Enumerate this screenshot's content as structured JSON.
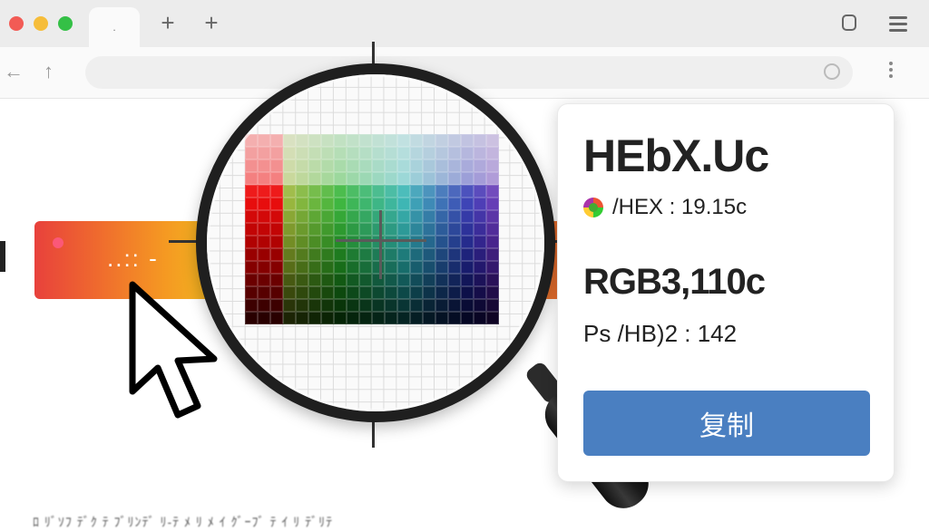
{
  "browser": {
    "tab_label": ".",
    "new_tab_symbol": "+",
    "back_symbol": "←",
    "forward_symbol": "↑"
  },
  "page": {
    "bar_text": "..:: -",
    "footer_text": "ﾛ ﾘﾞｿﾌ ﾃﾞｸ ﾃ ﾌﾞﾘﾝﾃﾞ ﾘ-ﾃ ﾒ ﾘ ﾒ ｲ ｸﾞｰﾌﾞ ﾃ ｲ ﾘ ﾃﾞﾘﾃ"
  },
  "colors": {
    "accent_button": "#4a7fc1",
    "magnifier_frame": "#1f1f1f"
  },
  "color_info": {
    "title": "HEbX.Uc",
    "hex_line": "/HEX : 19.15c",
    "rgb_line": "RGB3,110c",
    "hsb_line": "Ps /HB)2 : 142",
    "copy_label": "复制"
  },
  "icons": {
    "magnifier": "magnifying-glass-icon",
    "cursor": "mouse-pointer-icon",
    "swatch": "color-wheel-icon"
  }
}
